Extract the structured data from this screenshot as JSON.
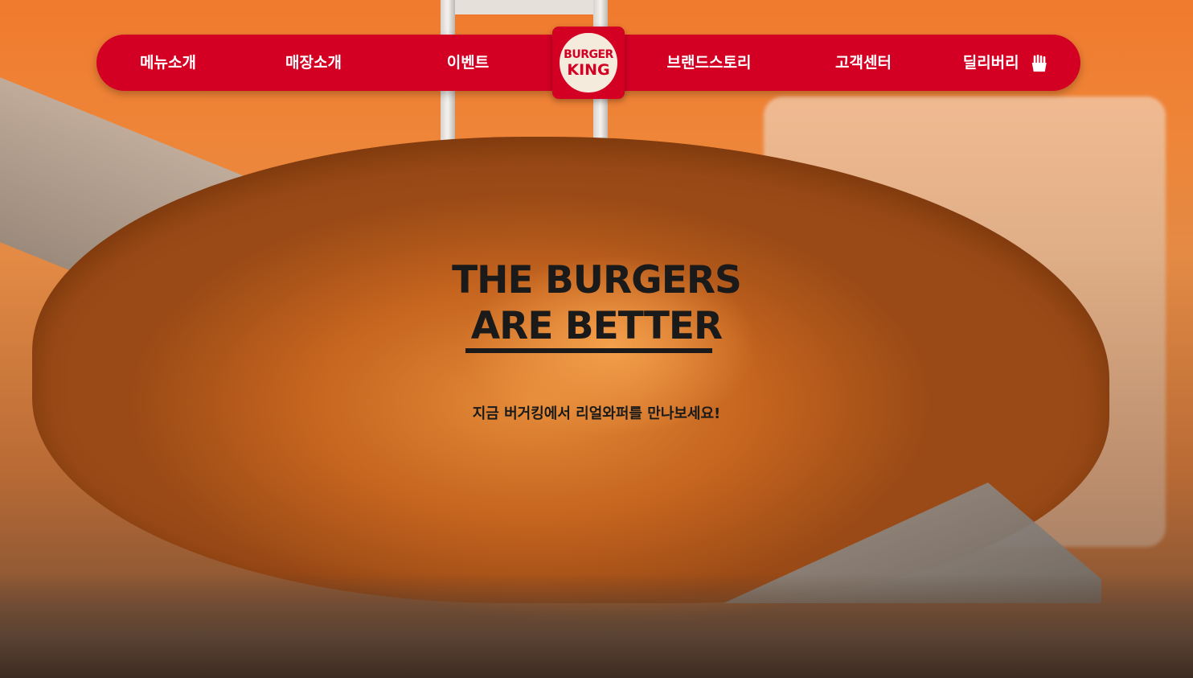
{
  "nav": {
    "items": [
      {
        "label": "메뉴소개"
      },
      {
        "label": "매장소개"
      },
      {
        "label": "이벤트"
      },
      {
        "label": "브랜드스토리"
      },
      {
        "label": "고객센터"
      },
      {
        "label": "딜리버리",
        "icon": "fries-icon"
      }
    ],
    "logo": {
      "line1": "BURGER",
      "line2": "KING"
    }
  },
  "hero": {
    "headline_line1": "THE BURGERS",
    "headline_line2": "ARE BETTER",
    "subtext": "지금 버거킹에서 리얼와퍼를 만나보세요!"
  },
  "colors": {
    "brand_red": "#d40024",
    "headline": "#1a1a1a",
    "bun": "#f5ebdc"
  }
}
